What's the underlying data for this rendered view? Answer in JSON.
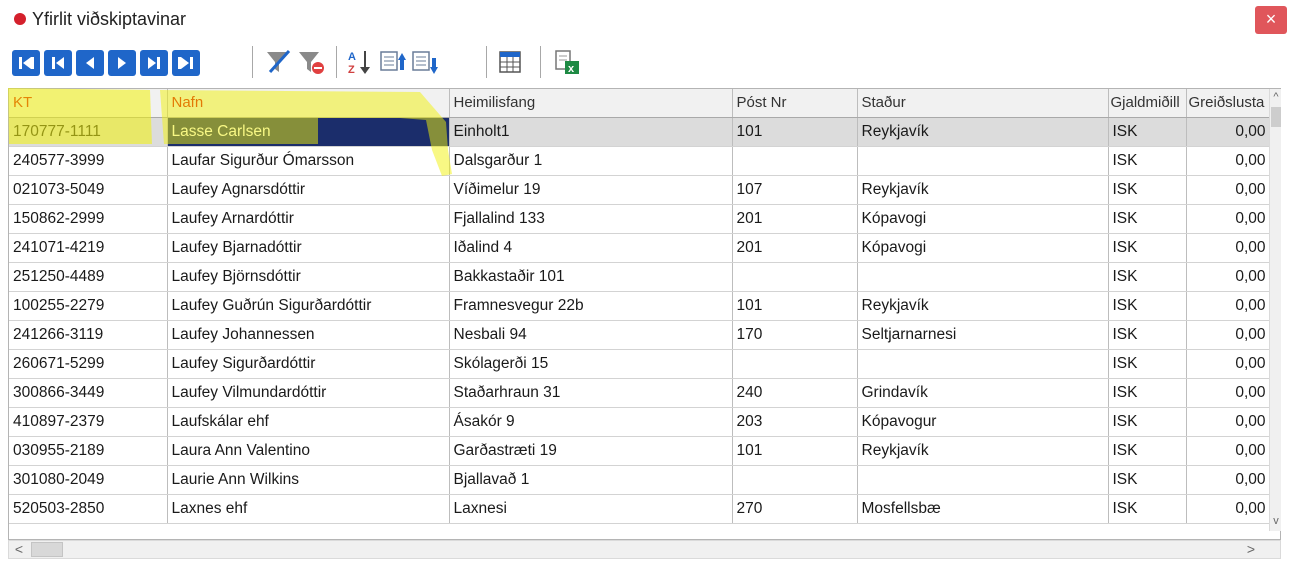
{
  "window": {
    "title": "Yfirlit viðskiptavinar",
    "close_glyph": "×",
    "status_dot_color": "#d4202c"
  },
  "toolbar": {
    "nav_buttons": [
      "first-record-icon",
      "prev-page-icon",
      "prev-record-icon",
      "next-record-icon",
      "next-page-icon",
      "last-record-icon"
    ],
    "tools": [
      "filter-icon",
      "clear-filter-icon",
      "sort-az-icon",
      "export-up-icon",
      "export-down-icon",
      "grid-columns-icon",
      "excel-export-icon"
    ],
    "accent_color": "#1f66c9"
  },
  "grid": {
    "columns": [
      "KT",
      "Nafn",
      "Heimilisfang",
      "Póst Nr",
      "Staður",
      "Gjaldmiðill",
      "Greiðslusta"
    ],
    "highlighted_columns": [
      "KT",
      "Nafn"
    ],
    "selected_row": 0,
    "selected_column": "Nafn",
    "rows": [
      {
        "kt": "170777-1111",
        "nafn": "Lasse Carlsen",
        "heimilisfang": "Einholt1",
        "postnr": "101",
        "stadur": "Reykjavík",
        "gjaldmidill": "ISK",
        "greidslusta": "0,00"
      },
      {
        "kt": "240577-3999",
        "nafn": "Laufar Sigurður Ómarsson",
        "heimilisfang": "Dalsgarður 1",
        "postnr": "",
        "stadur": "",
        "gjaldmidill": "ISK",
        "greidslusta": "0,00"
      },
      {
        "kt": "021073-5049",
        "nafn": "Laufey Agnarsdóttir",
        "heimilisfang": "Víðimelur 19",
        "postnr": "107",
        "stadur": "Reykjavík",
        "gjaldmidill": "ISK",
        "greidslusta": "0,00"
      },
      {
        "kt": "150862-2999",
        "nafn": "Laufey Arnardóttir",
        "heimilisfang": "Fjallalind 133",
        "postnr": "201",
        "stadur": "Kópavogi",
        "gjaldmidill": "ISK",
        "greidslusta": "0,00"
      },
      {
        "kt": "241071-4219",
        "nafn": "Laufey Bjarnadóttir",
        "heimilisfang": "Iðalind 4",
        "postnr": "201",
        "stadur": "Kópavogi",
        "gjaldmidill": "ISK",
        "greidslusta": "0,00"
      },
      {
        "kt": "251250-4489",
        "nafn": "Laufey Björnsdóttir",
        "heimilisfang": "Bakkastaðir 101",
        "postnr": "",
        "stadur": "",
        "gjaldmidill": "ISK",
        "greidslusta": "0,00"
      },
      {
        "kt": "100255-2279",
        "nafn": "Laufey Guðrún Sigurðardóttir",
        "heimilisfang": "Framnesvegur 22b",
        "postnr": "101",
        "stadur": "Reykjavík",
        "gjaldmidill": "ISK",
        "greidslusta": "0,00"
      },
      {
        "kt": "241266-3119",
        "nafn": "Laufey Johannessen",
        "heimilisfang": "Nesbali 94",
        "postnr": "170",
        "stadur": "Seltjarnarnesi",
        "gjaldmidill": "ISK",
        "greidslusta": "0,00"
      },
      {
        "kt": "260671-5299",
        "nafn": "Laufey Sigurðardóttir",
        "heimilisfang": "Skólagerði 15",
        "postnr": "",
        "stadur": "",
        "gjaldmidill": "ISK",
        "greidslusta": "0,00"
      },
      {
        "kt": "300866-3449",
        "nafn": "Laufey Vilmundardóttir",
        "heimilisfang": "Staðarhraun 31",
        "postnr": "240",
        "stadur": "Grindavík",
        "gjaldmidill": "ISK",
        "greidslusta": "0,00"
      },
      {
        "kt": "410897-2379",
        "nafn": "Laufskálar ehf",
        "heimilisfang": "Ásakór 9",
        "postnr": "203",
        "stadur": "Kópavogur",
        "gjaldmidill": "ISK",
        "greidslusta": "0,00"
      },
      {
        "kt": "030955-2189",
        "nafn": "Laura Ann Valentino",
        "heimilisfang": "Garðastræti 19",
        "postnr": "101",
        "stadur": "Reykjavík",
        "gjaldmidill": "ISK",
        "greidslusta": "0,00"
      },
      {
        "kt": "301080-2049",
        "nafn": "Laurie Ann Wilkins",
        "heimilisfang": "Bjallavað 1",
        "postnr": "",
        "stadur": "",
        "gjaldmidill": "ISK",
        "greidslusta": "0,00"
      },
      {
        "kt": "520503-2850",
        "nafn": "Laxnes ehf",
        "heimilisfang": "Laxnesi",
        "postnr": "270",
        "stadur": "Mosfellsbæ",
        "gjaldmidill": "ISK",
        "greidslusta": "0,00"
      }
    ]
  },
  "scrollbars": {
    "up": "^",
    "down": "v",
    "left": "<",
    "right": ">"
  }
}
